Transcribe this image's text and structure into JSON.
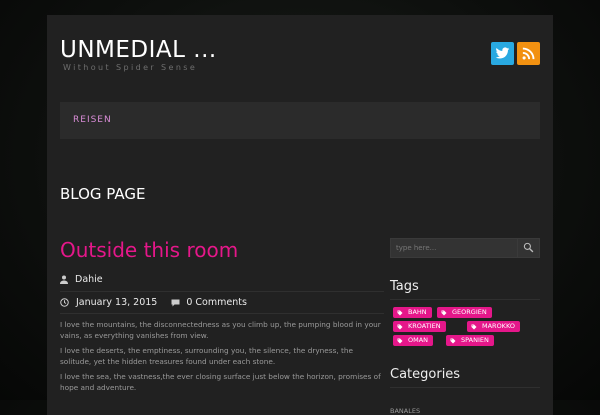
{
  "site": {
    "title": "UNMEDIAL ...",
    "tagline": "Without Spider Sense"
  },
  "social": [
    {
      "name": "twitter",
      "color": "#29a9e1"
    },
    {
      "name": "rss",
      "color": "#f29111"
    }
  ],
  "nav": {
    "items": [
      {
        "label": "REISEN"
      }
    ]
  },
  "page": {
    "heading": "BLOG PAGE"
  },
  "post": {
    "title": "Outside this room",
    "author": "Dahie",
    "date": "January 13, 2015",
    "comments": "0 Comments",
    "paragraphs": [
      "I love the mountains, the disconnectedness as you climb up, the pumping blood in your vains, as everything vanishes from view.",
      "I love the deserts, the emptiness, surrounding you, the silence, the dryness, the solitude, yet the hidden treasures found under each stone.",
      "I love the sea, the vastness,the ever closing surface just below the horizon, promises of hope and adventure."
    ]
  },
  "sidebar": {
    "search": {
      "placeholder": "type here..."
    },
    "tags": {
      "title": "Tags",
      "items": [
        "BAHN",
        "GEORGIEN",
        "KROATIEN",
        "MAROKKO",
        "OMAN",
        "SPANIEN"
      ]
    },
    "categories": {
      "title": "Categories",
      "items": [
        "BANALES"
      ]
    }
  },
  "colors": {
    "accent": "#e5178a",
    "nav_link": "#d88cd6",
    "panel": "#212121"
  }
}
